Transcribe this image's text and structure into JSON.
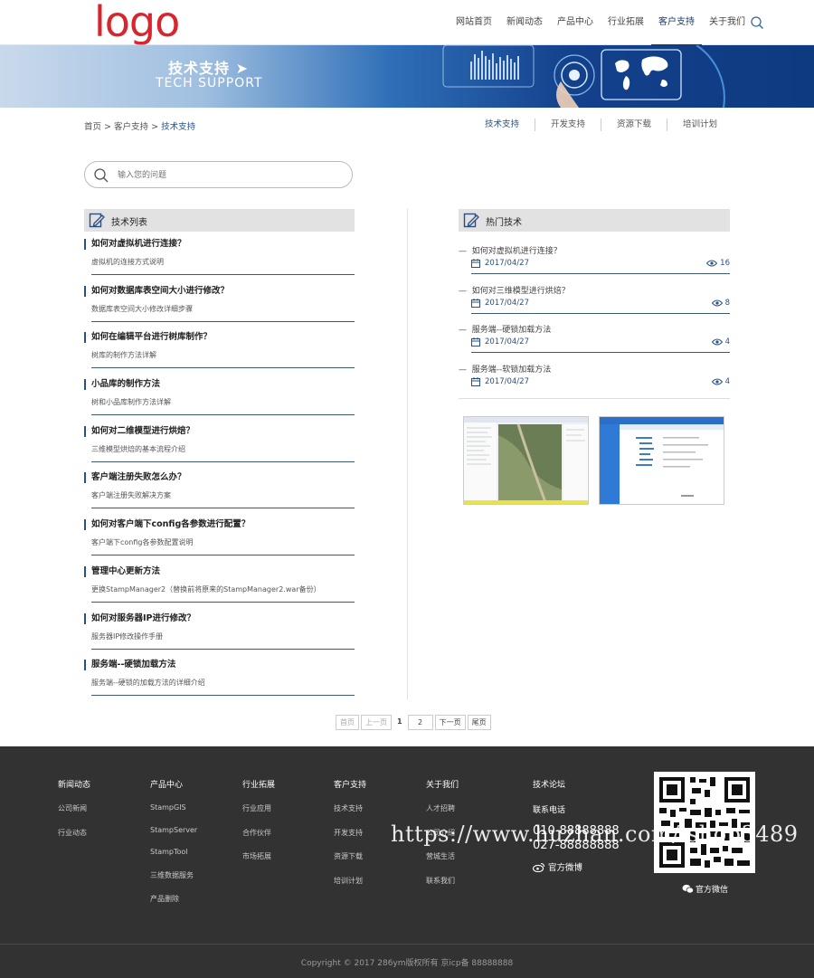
{
  "header": {
    "logo": "logo",
    "nav": [
      "网站首页",
      "新闻动态",
      "产品中心",
      "行业拓展",
      "客户支持",
      "关于我们"
    ],
    "active_nav": "客户支持"
  },
  "banner": {
    "title": "技术支持 ➤",
    "subtitle": "TECH SUPPORT"
  },
  "breadcrumb": {
    "items": [
      "首页",
      "客户支持",
      "技术支持"
    ],
    "separator": ">"
  },
  "subnav": [
    "技术支持",
    "开发支持",
    "资源下载",
    "培训计划"
  ],
  "search": {
    "placeholder": "输入您的问题"
  },
  "tech_list": {
    "title": "技术列表",
    "items": [
      {
        "title": "如何对虚拟机进行连接？",
        "desc": "虚拟机的连接方式说明"
      },
      {
        "title": "如何对数据库表空间大小进行修改？",
        "desc": "数据库表空间大小修改详细步骤"
      },
      {
        "title": "如何在编辑平台进行树库制作？",
        "desc": "树库的制作方法详解"
      },
      {
        "title": "小品库的制作方法",
        "desc": "树和小品库制作方法详解"
      },
      {
        "title": "如何对二维模型进行烘焙？",
        "desc": "三维模型烘焙的基本流程介绍"
      },
      {
        "title": "客户端注册失败怎么办？",
        "desc": "客户端注册失败解决方案"
      },
      {
        "title": "如何对客户端下config各参数进行配置？",
        "desc": "客户端下config各参数配置说明"
      },
      {
        "title": "管理中心更新方法",
        "desc": "更换StampManager2（替换前将原来的StampManager2.war备份）"
      },
      {
        "title": "如何对服务器IP进行修改？",
        "desc": "服务器IP修改操作手册"
      },
      {
        "title": "服务端--硬锁加载方法",
        "desc": "服务端--硬锁的加载方法的详细介绍"
      }
    ]
  },
  "hot_tech": {
    "title": "热门技术",
    "items": [
      {
        "title": "如何对虚拟机进行连接？",
        "date": "2017/04/27",
        "views": "16"
      },
      {
        "title": "如何对三维模型进行烘焙？",
        "date": "2017/04/27",
        "views": "8"
      },
      {
        "title": "服务端--硬锁加载方法",
        "date": "2017/04/27",
        "views": "4"
      },
      {
        "title": "服务端--软锁加载方法",
        "date": "2017/04/27",
        "views": "4"
      }
    ]
  },
  "pagination": {
    "first": "首页",
    "prev": "上一页",
    "current": "1",
    "page2": "2",
    "next": "下一页",
    "last": "尾页"
  },
  "footer": {
    "columns": [
      {
        "heading": "新闻动态",
        "links": [
          "公司新闻",
          "行业动态"
        ]
      },
      {
        "heading": "产品中心",
        "links": [
          "StampGIS",
          "StampServer",
          "StampTool",
          "三维数据服务",
          "产品删除"
        ]
      },
      {
        "heading": "行业拓展",
        "links": [
          "行业应用",
          "合作伙伴",
          "市场拓展"
        ]
      },
      {
        "heading": "客户支持",
        "links": [
          "技术支持",
          "开发支持",
          "资源下载",
          "培训计划"
        ]
      },
      {
        "heading": "关于我们",
        "links": [
          "人才招聘",
          "公司介绍",
          "营城生活",
          "联系我们"
        ]
      }
    ],
    "forum": "技术论坛",
    "phone_label": "联系电话",
    "phones": [
      "010-88888888",
      "027-88888888"
    ],
    "weibo": "官方微博",
    "wechat": "官方微信",
    "copyright": "Copyright © 2017 286ym版权所有  京icp备 88888888",
    "watermark": "https://www.huzhan.com/ishop3489"
  }
}
